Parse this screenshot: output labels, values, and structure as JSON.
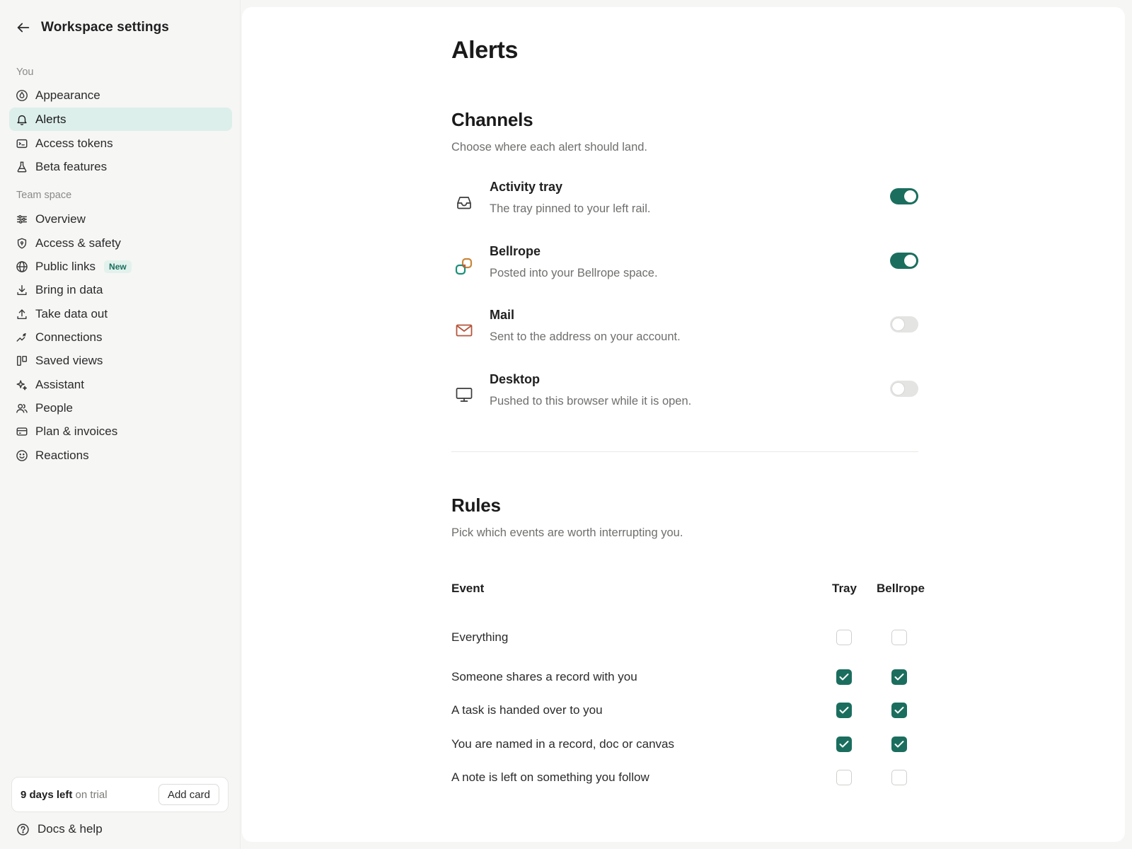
{
  "sidebar": {
    "title": "Workspace settings",
    "sections": [
      {
        "label": "You",
        "items": [
          {
            "label": "Appearance",
            "icon": "droplet-icon"
          },
          {
            "label": "Alerts",
            "icon": "bell-icon",
            "active": true
          },
          {
            "label": "Access tokens",
            "icon": "terminal-icon"
          },
          {
            "label": "Beta features",
            "icon": "flask-icon"
          }
        ]
      },
      {
        "label": "Team space",
        "items": [
          {
            "label": "Overview",
            "icon": "sliders-icon"
          },
          {
            "label": "Access & safety",
            "icon": "shield-icon"
          },
          {
            "label": "Public links",
            "icon": "globe-icon",
            "badge": "New"
          },
          {
            "label": "Bring in data",
            "icon": "download-icon"
          },
          {
            "label": "Take data out",
            "icon": "upload-icon"
          },
          {
            "label": "Connections",
            "icon": "connection-icon"
          },
          {
            "label": "Saved views",
            "icon": "columns-icon"
          },
          {
            "label": "Assistant",
            "icon": "sparkle-icon"
          },
          {
            "label": "People",
            "icon": "people-icon"
          },
          {
            "label": "Plan & invoices",
            "icon": "credit-card-icon"
          },
          {
            "label": "Reactions",
            "icon": "smiley-icon"
          }
        ]
      }
    ],
    "trial": {
      "days_left": "9 days left",
      "suffix": "on trial",
      "button": "Add card"
    },
    "docs_help": "Docs & help"
  },
  "main": {
    "title": "Alerts",
    "channels": {
      "title": "Channels",
      "subtitle": "Choose where each alert should land.",
      "items": [
        {
          "name": "Activity tray",
          "desc": "The tray pinned to your left rail.",
          "icon": "inbox-tray-icon",
          "enabled": true
        },
        {
          "name": "Bellrope",
          "desc": "Posted into your Bellrope space.",
          "icon": "bellrope-logo-icon",
          "enabled": true
        },
        {
          "name": "Mail",
          "desc": "Sent to the address on your account.",
          "icon": "mail-icon",
          "enabled": false
        },
        {
          "name": "Desktop",
          "desc": "Pushed to this browser while it is open.",
          "icon": "monitor-icon",
          "enabled": false
        }
      ]
    },
    "rules": {
      "title": "Rules",
      "subtitle": "Pick which events are worth interrupting you.",
      "columns": [
        "Event",
        "Tray",
        "Bellrope"
      ],
      "rows": [
        {
          "event": "Everything",
          "tray": false,
          "bellrope": false
        },
        {
          "event": "Someone shares a record with you",
          "tray": true,
          "bellrope": true
        },
        {
          "event": "A task is handed over to you",
          "tray": true,
          "bellrope": true
        },
        {
          "event": "You are named in a record, doc or canvas",
          "tray": true,
          "bellrope": true
        },
        {
          "event": "A note is left on something you follow",
          "tray": false,
          "bellrope": false
        }
      ]
    }
  },
  "colors": {
    "accent": "#1b6e5e",
    "active_bg": "#dcefeb",
    "mail_icon": "#b5553c"
  }
}
